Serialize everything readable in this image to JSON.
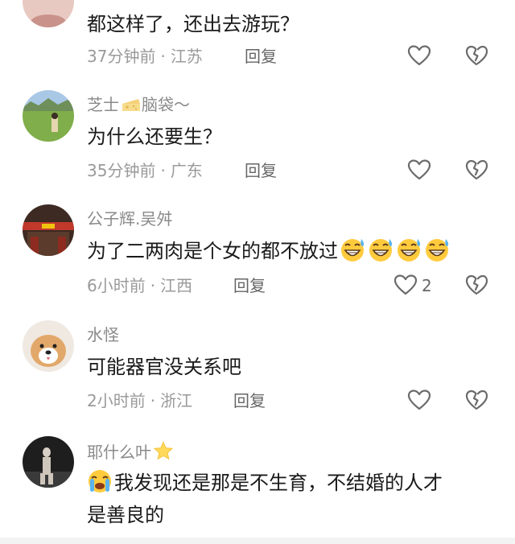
{
  "comments": [
    {
      "username": "",
      "text": "都这样了，还出去游玩？",
      "time": "37分钟前",
      "location": "江苏",
      "reply": "回复",
      "likes": ""
    },
    {
      "username": "芝士",
      "username_suffix": "脑袋～",
      "text": "为什么还要生？",
      "time": "35分钟前",
      "location": "广东",
      "reply": "回复",
      "likes": ""
    },
    {
      "username": "公子辉.吴舛",
      "text": "为了二两肉是个女的都不放过",
      "time": "6小时前",
      "location": "江西",
      "reply": "回复",
      "likes": "2"
    },
    {
      "username": "水怪",
      "text": "可能器官没关系吧",
      "time": "2小时前",
      "location": "浙江",
      "reply": "回复",
      "likes": ""
    },
    {
      "username": "耶什么叶",
      "text_line1": "我发现还是那是不生育，不结婚的人才",
      "text_line2": "是善良的"
    }
  ],
  "meta_separator": "·",
  "icons": {
    "like": "heart-outline-icon",
    "dislike": "broken-heart-icon",
    "laugh": "grinning-sweat-emoji",
    "cry": "loudly-crying-emoji",
    "cheese": "cheese-emoji",
    "star": "star-emoji"
  },
  "colors": {
    "text": "#1a1a1a",
    "secondary": "#8a8a8a",
    "icon": "#6b6b6b"
  }
}
